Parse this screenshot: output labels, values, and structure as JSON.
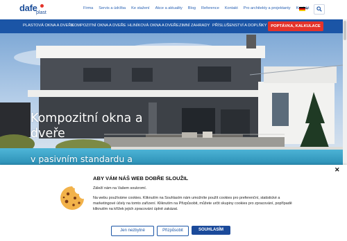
{
  "logo": {
    "brand": "dafe",
    "sub": "plast"
  },
  "topnav": [
    "Firma",
    "Servis a údržba",
    "Ke stažení",
    "Akce a aktuality",
    "Blog",
    "Reference",
    "Kontakt",
    "Pro architekty a projektanty",
    "Kontakt"
  ],
  "language": {
    "icon": "flag-de-icon"
  },
  "mainnav": {
    "items": [
      "PLASTOVÁ OKNA A DVEŘE",
      "KOMPOZITNÍ OKNA A DVEŘE",
      "HLINÍKOVÁ OKNA A DVEŘE",
      "ZIMNÍ ZAHRADY",
      "PŘÍSLUŠENSTVÍ A DOPLŇKY"
    ],
    "cta": "POPTÁVKA, KALKULACE"
  },
  "hero": {
    "headline": "Kompozitní okna a dveře",
    "subline": "v pasivním standardu a skvělém designu"
  },
  "cookie": {
    "title": "ABY VÁM NÁŠ WEB DOBŘE SLOUŽIL",
    "p1": "Záleží nám na Vašem soukromí.",
    "p2": "Na webu používáme cookies. Kliknutím na Souhlasím nám umožníte použít cookies pro preferenční, statistické a marketingové účely na tomto zařízení. Kliknutím na Přizpůsobit, můžete určit skupiny cookies pro zpracování, popřípadě kliknutím na křížek jejich zpracování úplně zakázat.",
    "buttons": {
      "reject": "Jen nezbytné",
      "customize": "Přizpůsobit",
      "accept": "SOUHLASÍM"
    }
  },
  "colors": {
    "nav_blue": "#1b55a6",
    "cta_red": "#e4332a",
    "link_blue": "#2b63b4"
  }
}
